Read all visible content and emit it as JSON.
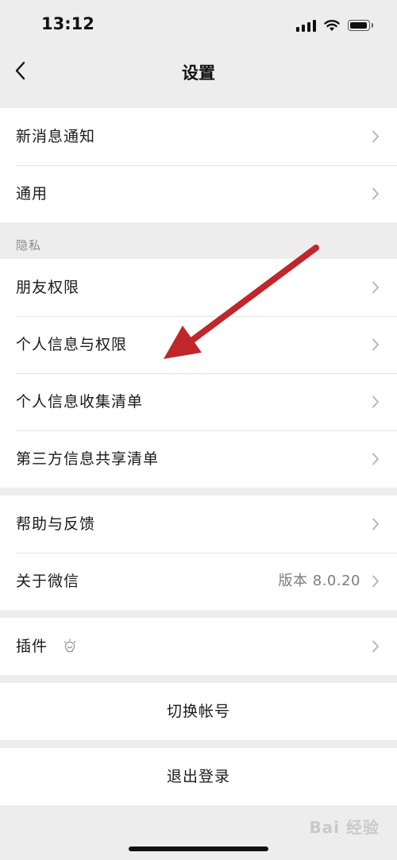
{
  "status_bar": {
    "time": "13:12"
  },
  "nav": {
    "title": "设置"
  },
  "groups": {
    "general": [
      {
        "label": "新消息通知"
      },
      {
        "label": "通用"
      }
    ],
    "privacy_header": "隐私",
    "privacy": [
      {
        "label": "朋友权限"
      },
      {
        "label": "个人信息与权限"
      },
      {
        "label": "个人信息收集清单"
      },
      {
        "label": "第三方信息共享清单"
      }
    ],
    "about": [
      {
        "label": "帮助与反馈"
      },
      {
        "label": "关于微信",
        "value": "版本 8.0.20"
      }
    ],
    "plugins": [
      {
        "label": "插件"
      }
    ]
  },
  "actions": {
    "switch_account": "切换帐号",
    "logout": "退出登录"
  },
  "watermark": "Bai 经验",
  "colors": {
    "background": "#ededed",
    "card": "#ffffff",
    "annotation_arrow": "#c0262a"
  },
  "icons": [
    "back-icon",
    "chevron-right-icon",
    "plugin-bulb-icon",
    "signal-icon",
    "wifi-icon",
    "battery-icon"
  ]
}
